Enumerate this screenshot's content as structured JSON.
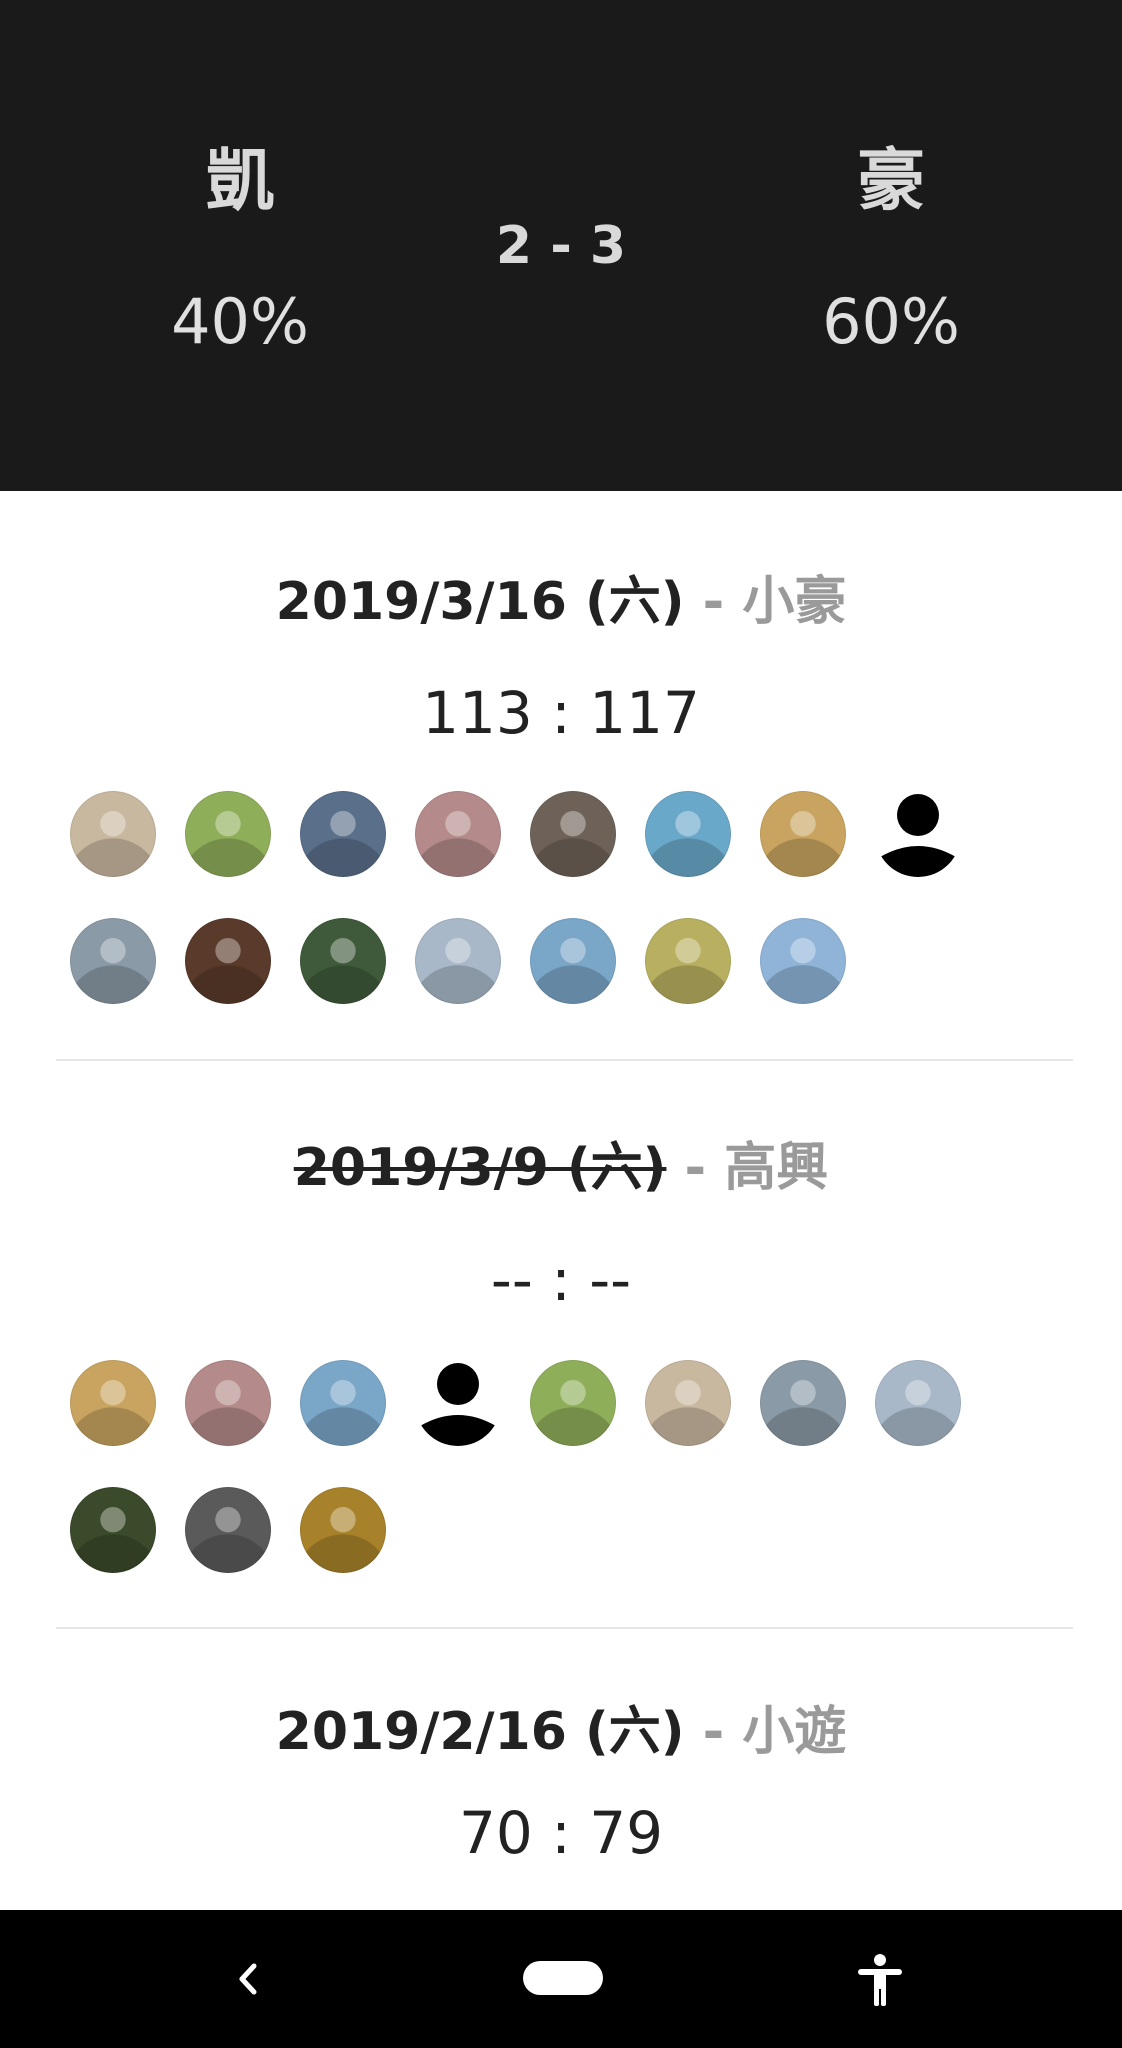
{
  "header": {
    "team_left": "凱",
    "team_right": "豪",
    "score": "2 - 3",
    "pct_left": "40%",
    "pct_right": "60%"
  },
  "matches": [
    {
      "date": "2019/3/16 (六)",
      "separator": " - ",
      "host": "小豪",
      "canceled": false,
      "score": "113 : 117",
      "avatars": [
        {
          "kind": "photo",
          "color": "#c9b8a0"
        },
        {
          "kind": "photo",
          "color": "#8fae5a"
        },
        {
          "kind": "photo",
          "color": "#5a6f8a"
        },
        {
          "kind": "photo",
          "color": "#b48a8a"
        },
        {
          "kind": "photo",
          "color": "#6e6258"
        },
        {
          "kind": "photo",
          "color": "#6aa8c9"
        },
        {
          "kind": "photo",
          "color": "#c8a460"
        },
        {
          "kind": "generic",
          "color": "#000000"
        },
        {
          "kind": "photo",
          "color": "#8a9aa6"
        },
        {
          "kind": "photo",
          "color": "#5a3a2a"
        },
        {
          "kind": "photo",
          "color": "#3f5a3a"
        },
        {
          "kind": "photo",
          "color": "#a8b8c8"
        },
        {
          "kind": "photo",
          "color": "#7aa6c8"
        },
        {
          "kind": "photo",
          "color": "#b8b060"
        },
        {
          "kind": "photo",
          "color": "#8fb4d8"
        }
      ]
    },
    {
      "date": "2019/3/9 (六)",
      "separator": " - ",
      "host": "高興",
      "canceled": true,
      "score": "-- : --",
      "avatars": [
        {
          "kind": "photo",
          "color": "#c8a460"
        },
        {
          "kind": "photo",
          "color": "#b48a8a"
        },
        {
          "kind": "photo",
          "color": "#7aa6c8"
        },
        {
          "kind": "generic",
          "color": "#000000"
        },
        {
          "kind": "photo",
          "color": "#8fae5a"
        },
        {
          "kind": "photo",
          "color": "#c9b8a0"
        },
        {
          "kind": "photo",
          "color": "#8a9aa6"
        },
        {
          "kind": "photo",
          "color": "#a8b8c8"
        },
        {
          "kind": "photo",
          "color": "#3a4a2a"
        },
        {
          "kind": "photo",
          "color": "#5a5a5a"
        },
        {
          "kind": "photo",
          "color": "#a8822a"
        }
      ]
    },
    {
      "date": "2019/2/16 (六)",
      "separator": " - ",
      "host": "小遊",
      "canceled": false,
      "score": "70 : 79",
      "avatars": []
    }
  ],
  "navbar": {
    "back_icon": "back-icon",
    "home_icon": "home-pill-icon",
    "accessibility_icon": "accessibility-icon"
  }
}
